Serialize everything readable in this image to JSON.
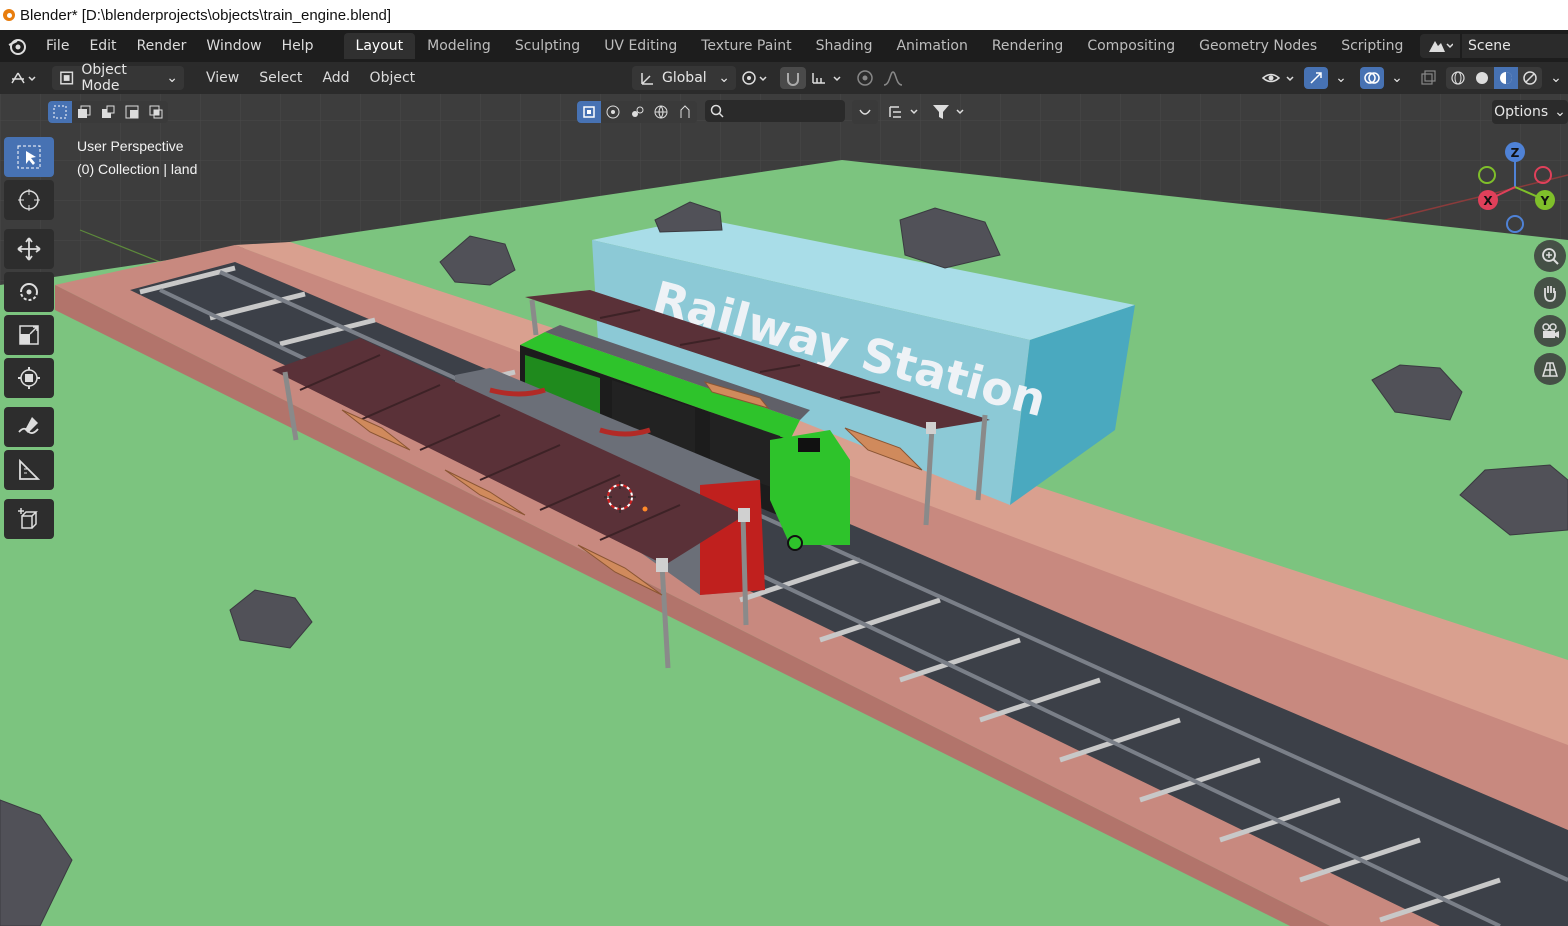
{
  "window": {
    "title": "Blender* [D:\\blenderprojects\\objects\\train_engine.blend]"
  },
  "menu": [
    "File",
    "Edit",
    "Render",
    "Window",
    "Help"
  ],
  "workspaces": [
    "Layout",
    "Modeling",
    "Sculpting",
    "UV Editing",
    "Texture Paint",
    "Shading",
    "Animation",
    "Rendering",
    "Compositing",
    "Geometry Nodes",
    "Scripting"
  ],
  "active_workspace": "Layout",
  "scene": {
    "name": "Scene"
  },
  "header": {
    "mode": "Object Mode",
    "menus": [
      "View",
      "Select",
      "Add",
      "Object"
    ],
    "orientation": "Global",
    "options_label": "Options"
  },
  "viewport": {
    "perspective_label": "User Perspective",
    "collection_label": "(0) Collection | land",
    "station_sign": "Railway Station",
    "gizmo": {
      "z": "Z",
      "y": "Y",
      "x": "X"
    }
  },
  "colors": {
    "accent": "#4772b3",
    "ground": "#7cc47f",
    "platform": "#c8897f",
    "station": "#8cc9d6",
    "roof": "#5a3138",
    "engine": "#2ec32b"
  },
  "icons": {
    "tools": [
      "select-box-icon",
      "cursor-icon",
      "move-icon",
      "rotate-icon",
      "scale-icon",
      "transform-icon",
      "annotate-icon",
      "measure-icon",
      "add-cube-icon"
    ],
    "nav": [
      "zoom-icon",
      "hand-pan-icon",
      "camera-icon",
      "grid-icon"
    ]
  }
}
